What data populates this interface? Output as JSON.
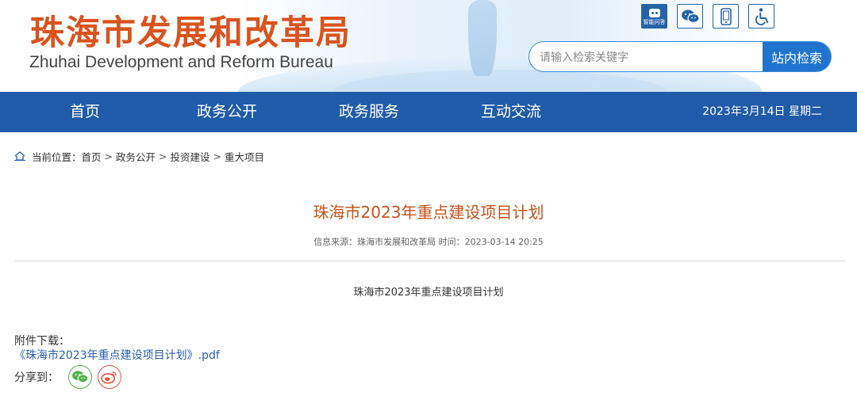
{
  "header": {
    "logo_cn": "珠海市发展和改革局",
    "logo_en": "Zhuhai Development and Reform Bureau",
    "tools": [
      {
        "icon": "robot-icon",
        "label": "智能问答"
      },
      {
        "icon": "wechat-icon"
      },
      {
        "icon": "mobile-icon"
      },
      {
        "icon": "accessibility-icon"
      }
    ],
    "search": {
      "placeholder": "请输入检索关键字",
      "button": "站内检索"
    }
  },
  "nav": {
    "items": [
      "首页",
      "政务公开",
      "政务服务",
      "互动交流"
    ],
    "date": "2023年3月14日 星期二",
    "color": "#1f5ba8"
  },
  "breadcrumb": {
    "prefix": "当前位置：",
    "items": [
      "首页",
      "政务公开",
      "投资建设",
      "重大项目"
    ],
    "separator": ">"
  },
  "article": {
    "title": "珠海市2023年重点建设项目计划",
    "meta": "信息来源：珠海市发展和改革局 时间：2023-03-14 20:25",
    "body": "珠海市2023年重点建设项目计划",
    "attachment_label": "附件下载：",
    "attachment_link": "《珠海市2023年重点建设项目计划》.pdf",
    "title_color": "#c8521a"
  },
  "share": {
    "label": "分享到：",
    "targets": [
      {
        "icon": "wechat-icon"
      },
      {
        "icon": "weibo-icon"
      }
    ]
  }
}
